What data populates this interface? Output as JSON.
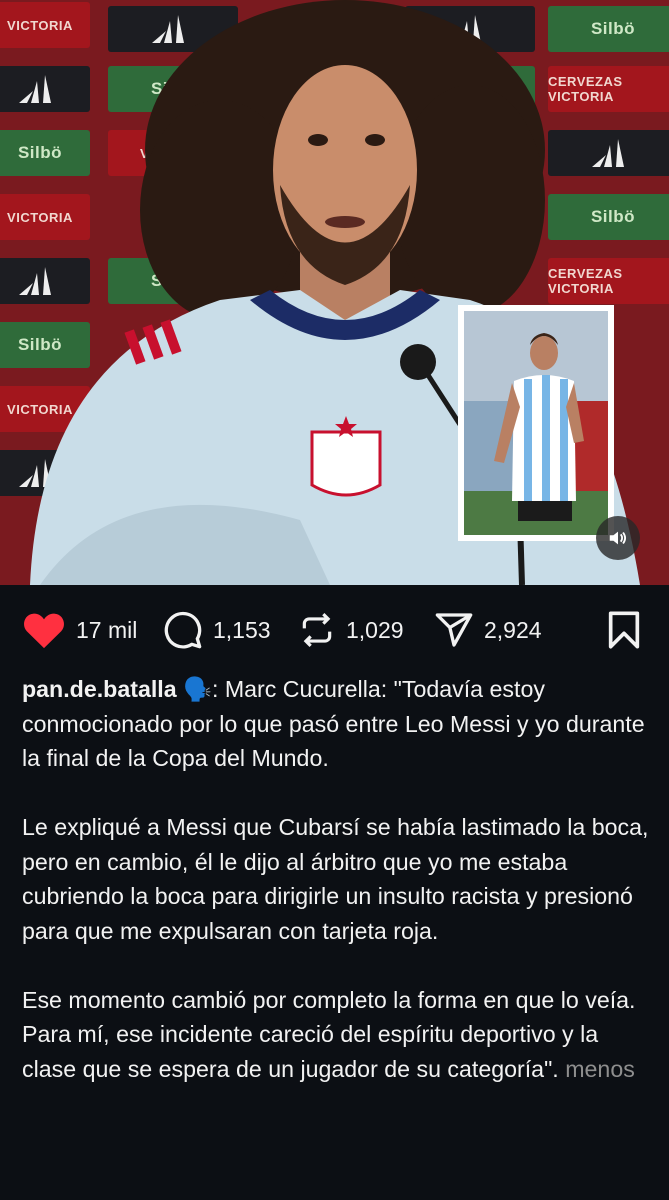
{
  "post": {
    "backdrop_logos": {
      "sponsor_a": "Silbö",
      "sponsor_b": "CERVEZAS VICTORIA",
      "sponsor_b_short": "VICTORIA"
    },
    "colors": {
      "like_red": "#ff3040",
      "background": "#0c0f14",
      "text": "#f2f2f2",
      "muted": "#8e8e8e"
    },
    "icons": {
      "like": "heart-icon",
      "comment": "speech-bubble-icon",
      "repost": "repost-arrows-icon",
      "share": "paper-plane-icon",
      "save": "bookmark-icon",
      "sound": "speaker-icon",
      "speaking_emoji": "🗣️"
    }
  },
  "actions": {
    "likes": "17 mil",
    "comments": "1,153",
    "reposts": "1,029",
    "shares": "2,924"
  },
  "caption": {
    "username": "pan.de.batalla",
    "emoji": "🗣️",
    "line1": ": Marc Cucurella: \"Todavía estoy conmocionado por lo que pasó entre Leo Messi y yo durante la final de la Copa del Mundo.",
    "para2": "Le expliqué a Messi que Cubarsí se había lastimado la boca, pero en cambio, él le dijo al árbitro que yo me estaba cubriendo la boca para dirigirle un insulto racista y presionó para que me expulsaran con tarjeta roja.",
    "para3a": "Ese momento cambió por completo la forma en que lo veía.",
    "para3b": "Para mí, ese incidente careció del espíritu deportivo y la clase que se espera de un jugador de su categoría\".",
    "more_label": "menos"
  }
}
